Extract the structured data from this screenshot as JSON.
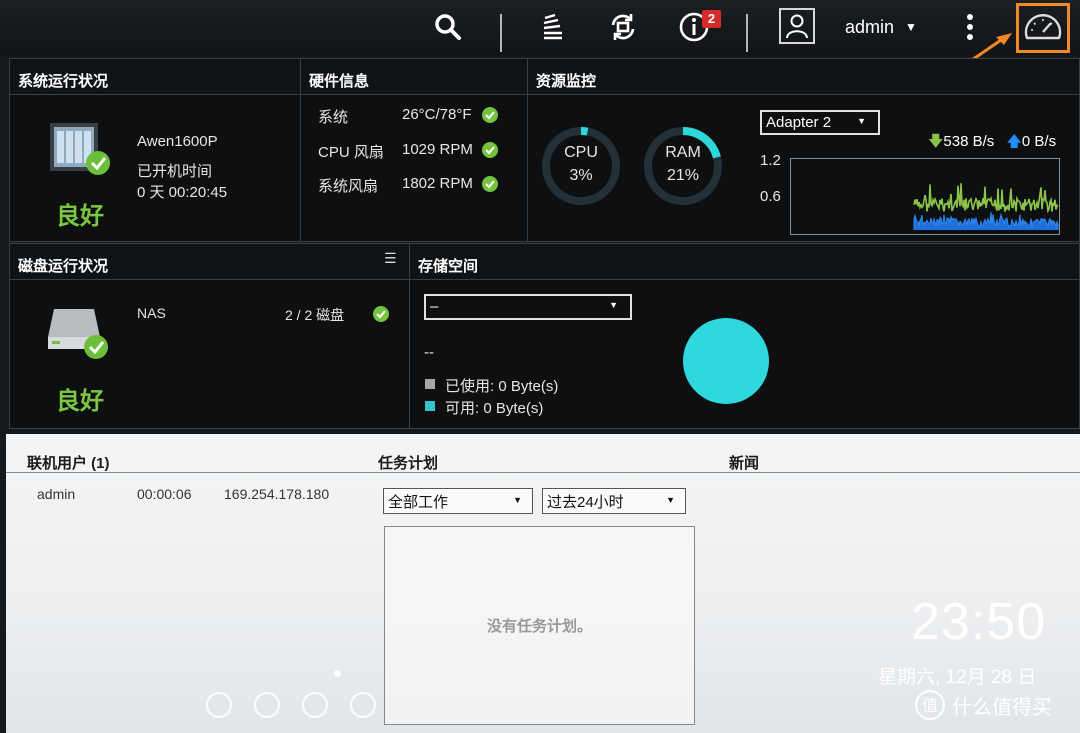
{
  "topbar": {
    "notifications_count": "2",
    "user": "admin",
    "icons": [
      "search-icon",
      "task-stack-icon",
      "sync-icon",
      "info-icon",
      "user-icon",
      "more-icon",
      "dashboard-gauge-icon"
    ]
  },
  "system_status": {
    "title": "系统运行状况",
    "device_name": "Awen1600P",
    "uptime_label": "已开机时间",
    "uptime_value": "0 天 00:20:45",
    "status": "良好"
  },
  "hardware": {
    "title": "硬件信息",
    "rows": [
      {
        "label": "系统",
        "value": "26°C/78°F"
      },
      {
        "label": "CPU 风扇",
        "value": "1029 RPM"
      },
      {
        "label": "系统风扇",
        "value": "1802 RPM"
      }
    ]
  },
  "resource": {
    "title": "资源监控",
    "cpu_label": "CPU",
    "cpu_value": "3%",
    "cpu_pct": 3,
    "ram_label": "RAM",
    "ram_value": "21%",
    "ram_pct": 21,
    "adapter": "Adapter 2",
    "download": "538 B/s",
    "upload": "0 B/s",
    "y_top": "1.2",
    "y_mid": "0.6"
  },
  "disk": {
    "title": "磁盘运行状况",
    "name": "NAS",
    "count": "2 / 2 磁盘",
    "status": "良好"
  },
  "storage": {
    "title": "存储空间",
    "select": "–",
    "volume": "--",
    "used": "已使用: 0 Byte(s)",
    "free": "可用: 0 Byte(s)"
  },
  "online_users": {
    "title": "联机用户 (1)",
    "rows": [
      {
        "user": "admin",
        "duration": "00:00:06",
        "ip": "169.254.178.180"
      }
    ]
  },
  "tasks": {
    "title": "任务计划",
    "filter": "全部工作",
    "range": "过去24小时",
    "empty": "没有任务计划。"
  },
  "news": {
    "title": "新闻"
  },
  "clock": {
    "time": "23:50",
    "date": "星期六, 12月 28 日"
  },
  "watermark": "什么值得买",
  "colors": {
    "accent_orange": "#f08a25",
    "good_green": "#7bc742",
    "teal": "#2ed8d8",
    "download_green": "#8bc34a",
    "upload_blue": "#1e90ff"
  }
}
